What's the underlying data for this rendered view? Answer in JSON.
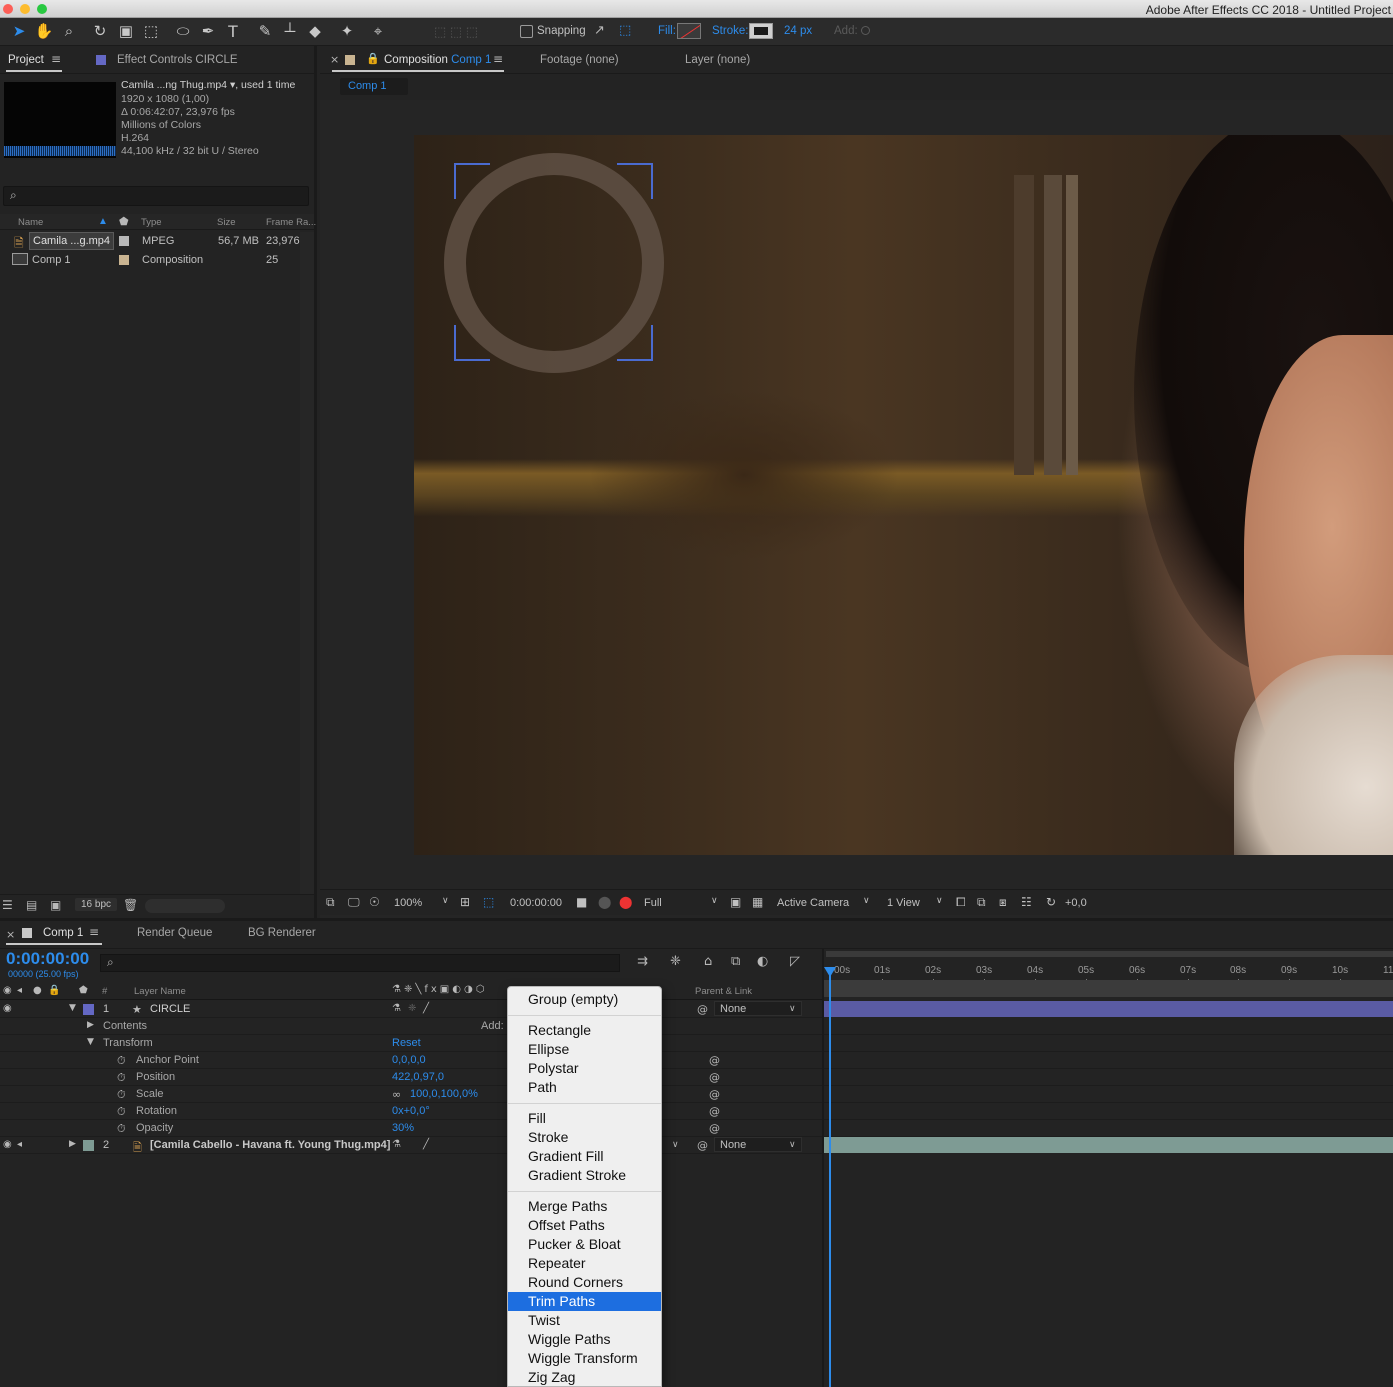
{
  "window": {
    "title": "Adobe After Effects CC 2018 - Untitled Project"
  },
  "toolbar": {
    "snapping_label": "Snapping",
    "fill_label": "Fill:",
    "stroke_label": "Stroke:",
    "stroke_width": "24 px",
    "add_label": "Add:"
  },
  "project_panel": {
    "tab_project": "Project",
    "tab_effect_controls": "Effect Controls CIRCLE",
    "footage_info": {
      "name": "Camila ...ng Thug.mp4 ▾",
      "usage": ", used 1 time",
      "resolution": "1920 x 1080 (1,00)",
      "duration": "Δ 0:06:42:07, 23,976 fps",
      "colors": "Millions of Colors",
      "codec": "H.264",
      "audio": "44,100 kHz / 32 bit U / Stereo"
    },
    "columns": {
      "name": "Name",
      "type": "Type",
      "size": "Size",
      "frame_rate": "Frame Ra..."
    },
    "items": [
      {
        "name": "Camila ...g.mp4",
        "type": "MPEG",
        "size": "56,7 MB",
        "frame_rate": "23,976"
      },
      {
        "name": "Comp 1",
        "type": "Composition",
        "size": "",
        "frame_rate": "25"
      }
    ],
    "bit_depth": "16 bpc"
  },
  "composition_panel": {
    "tab_composition_prefix": "Composition",
    "tab_composition_name": "Comp 1",
    "tab_footage": "Footage (none)",
    "tab_layer": "Layer (none)",
    "subtab": "Comp 1",
    "viewer_bar": {
      "zoom": "100%",
      "timecode": "0:00:00:00",
      "resolution": "Full",
      "camera": "Active Camera",
      "views": "1 View",
      "exposure": "+0,0"
    }
  },
  "timeline_panel": {
    "tab_comp": "Comp 1",
    "tab_render_queue": "Render Queue",
    "tab_bg_renderer": "BG Renderer",
    "timecode": "0:00:00:00",
    "fps": "00000 (25.00 fps)",
    "columns": {
      "number": "#",
      "layer_name": "Layer Name",
      "parent": "Parent & Link"
    },
    "ruler_ticks": [
      "00s",
      "01s",
      "02s",
      "03s",
      "04s",
      "05s",
      "06s",
      "07s",
      "08s",
      "09s",
      "10s",
      "11"
    ],
    "layer1": {
      "number": "1",
      "name": "CIRCLE",
      "parent": "None"
    },
    "contents_label": "Contents",
    "add_label": "Add:",
    "transform": {
      "label": "Transform",
      "reset": "Reset",
      "anchor_point": {
        "label": "Anchor Point",
        "value": "0,0,0,0"
      },
      "position": {
        "label": "Position",
        "value": "422,0,97,0"
      },
      "scale": {
        "label": "Scale",
        "value": "100,0,100,0%"
      },
      "rotation": {
        "label": "Rotation",
        "value": "0x+0,0°"
      },
      "opacity": {
        "label": "Opacity",
        "value": "30%"
      }
    },
    "layer2": {
      "number": "2",
      "name": "[Camila Cabello - Havana ft. Young Thug.mp4]",
      "parent": "None"
    }
  },
  "add_menu": {
    "group1": [
      "Group (empty)"
    ],
    "group2": [
      "Rectangle",
      "Ellipse",
      "Polystar",
      "Path"
    ],
    "group3": [
      "Fill",
      "Stroke",
      "Gradient Fill",
      "Gradient Stroke"
    ],
    "group4": [
      "Merge Paths",
      "Offset Paths",
      "Pucker & Bloat",
      "Repeater",
      "Round Corners",
      "Trim Paths",
      "Twist",
      "Wiggle Paths",
      "Wiggle Transform",
      "Zig Zag"
    ],
    "highlighted": "Trim Paths"
  },
  "colors": {
    "accent": "#2d8ceb",
    "layer1_label": "#6468c4",
    "layer2_label": "#7e9b94",
    "menu_highlight": "#1d6ee0"
  }
}
